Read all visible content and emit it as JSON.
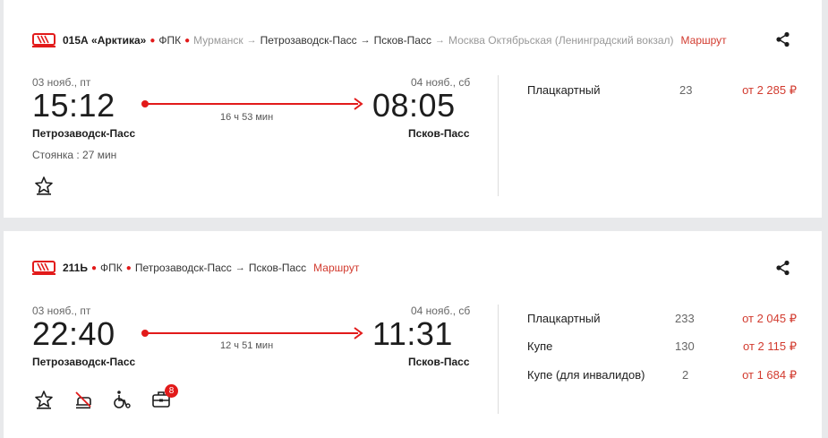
{
  "trains": [
    {
      "number": "015А «Арктика»",
      "carrier": "ФПК",
      "route_stations": [
        "Мурманск",
        "Петрозаводск-Пасс",
        "Псков-Пасс",
        "Москва Октябрьская (Ленинградский вокзал)"
      ],
      "route_link": "Маршрут",
      "departure": {
        "date": "03 нояб., пт",
        "time": "15:12",
        "station": "Петрозаводск-Пасс"
      },
      "arrival": {
        "date": "04 нояб., сб",
        "time": "08:05",
        "station": "Псков-Пасс"
      },
      "duration": "16 ч 53 мин",
      "stay": "Стоянка : 27 мин",
      "classes": [
        {
          "name": "Плацкартный",
          "seats": "23",
          "price": "от 2 285 ₽"
        }
      ],
      "icons": [
        "star-icon"
      ]
    },
    {
      "number": "211Ь",
      "carrier": "ФПК",
      "route_stations": [
        "Петрозаводск-Пасс",
        "Псков-Пасс"
      ],
      "route_link": "Маршрут",
      "departure": {
        "date": "03 нояб., пт",
        "time": "22:40",
        "station": "Петрозаводск-Пасс"
      },
      "arrival": {
        "date": "04 нояб., сб",
        "time": "11:31",
        "station": "Псков-Пасс"
      },
      "duration": "12 ч 51 мин",
      "classes": [
        {
          "name": "Плацкартный",
          "seats": "233",
          "price": "от 2 045 ₽"
        },
        {
          "name": "Купе",
          "seats": "130",
          "price": "от 2 115 ₽"
        },
        {
          "name": "Купе (для инвалидов)",
          "seats": "2",
          "price": "от 1 684 ₽"
        }
      ],
      "icons": [
        "star-icon",
        "no-bedding-icon",
        "wheelchair-icon",
        "luggage-icon"
      ],
      "luggage_badge": "8"
    }
  ],
  "colors": {
    "accent": "#e21a1a",
    "price": "#d23b2f",
    "muted": "#999999"
  }
}
